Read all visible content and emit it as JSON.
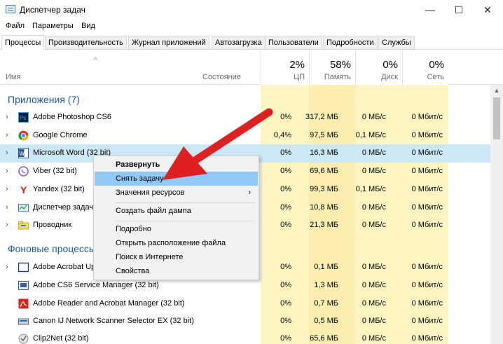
{
  "window": {
    "title": "Диспетчер задач",
    "minimize": "—",
    "maximize": "☐",
    "close": "✕"
  },
  "menu": [
    "Файл",
    "Параметры",
    "Вид"
  ],
  "tabs": [
    "Процессы",
    "Производительность",
    "Журнал приложений",
    "Автозагрузка",
    "Пользователи",
    "Подробности",
    "Службы"
  ],
  "header": {
    "sort_arrow": "^",
    "name": "Имя",
    "state": "Состояние",
    "cpu": {
      "pct": "2%",
      "label": "ЦП"
    },
    "memory": {
      "pct": "58%",
      "label": "Память"
    },
    "disk": {
      "pct": "0%",
      "label": "Диск"
    },
    "network": {
      "pct": "0%",
      "label": "Сеть"
    }
  },
  "sections": {
    "apps": "Приложения (7)",
    "background": "Фоновые процессы"
  },
  "apps": [
    {
      "name": "Adobe Photoshop CS6",
      "cpu": "0%",
      "mem": "317,2 МБ",
      "disk": "0 МБ/с",
      "net": "0 Мбит/с",
      "icon": "photoshop-icon"
    },
    {
      "name": "Google Chrome",
      "cpu": "0,4%",
      "mem": "97,5 МБ",
      "disk": "0,1 МБ/с",
      "net": "0 Мбит/с",
      "icon": "chrome-icon"
    },
    {
      "name": "Microsoft Word (32 bit)",
      "cpu": "0%",
      "mem": "16,3 МБ",
      "disk": "0 МБ/с",
      "net": "0 Мбит/с",
      "icon": "word-icon"
    },
    {
      "name": "Viber (32 bit)",
      "cpu": "0%",
      "mem": "69,6 МБ",
      "disk": "0 МБ/с",
      "net": "0 Мбит/с",
      "icon": "viber-icon"
    },
    {
      "name": "Yandex (32 bit)",
      "cpu": "0%",
      "mem": "99,3 МБ",
      "disk": "0,1 МБ/с",
      "net": "0 Мбит/с",
      "icon": "yandex-icon"
    },
    {
      "name": "Диспетчер задач",
      "cpu": "0%",
      "mem": "10,8 МБ",
      "disk": "0 МБ/с",
      "net": "0 Мбит/с",
      "icon": "task-manager-icon"
    },
    {
      "name": "Проводник",
      "cpu": "0%",
      "mem": "21,3 МБ",
      "disk": "0 МБ/с",
      "net": "0 Мбит/с",
      "icon": "explorer-icon"
    }
  ],
  "background": [
    {
      "name": "Adobe Acrobat Update Service (32 bit)",
      "cpu": "0%",
      "mem": "0,1 МБ",
      "disk": "0 МБ/с",
      "net": "0 Мбит/с",
      "icon": "acrobat-update-icon"
    },
    {
      "name": "Adobe CS6 Service Manager (32 bit)",
      "cpu": "0%",
      "mem": "1,3 МБ",
      "disk": "0 МБ/с",
      "net": "0 Мбит/с",
      "icon": "cs6-service-icon"
    },
    {
      "name": "Adobe Reader and Acrobat Manager (32 bit)",
      "cpu": "0%",
      "mem": "0,7 МБ",
      "disk": "0 МБ/с",
      "net": "0 Мбит/с",
      "icon": "acrobat-manager-icon"
    },
    {
      "name": "Canon IJ Network Scanner Selector EX (32 bit)",
      "cpu": "0%",
      "mem": "0,5 МБ",
      "disk": "0 МБ/с",
      "net": "0 Мбит/с",
      "icon": "canon-scanner-icon"
    },
    {
      "name": "Clip2Net (32 bit)",
      "cpu": "0%",
      "mem": "65,6 МБ",
      "disk": "0 МБ/с",
      "net": "0 Мбит/с",
      "icon": "clip2net-icon"
    }
  ],
  "context_menu": {
    "expand": "Развернуть",
    "end_task": "Снять задачу",
    "resource_values": "Значения ресурсов",
    "submenu_arrow": "›",
    "create_dump": "Создать файл дампа",
    "details": "Подробно",
    "open_location": "Открыть расположение файла",
    "search_online": "Поиск в Интернете",
    "properties": "Свойства"
  },
  "colors": {
    "highlight": "#fff5c2",
    "accent": "#1e5aa8",
    "selection": "#cce8f4",
    "menu_highlight": "#91c9f7",
    "arrow": "#e02020"
  }
}
